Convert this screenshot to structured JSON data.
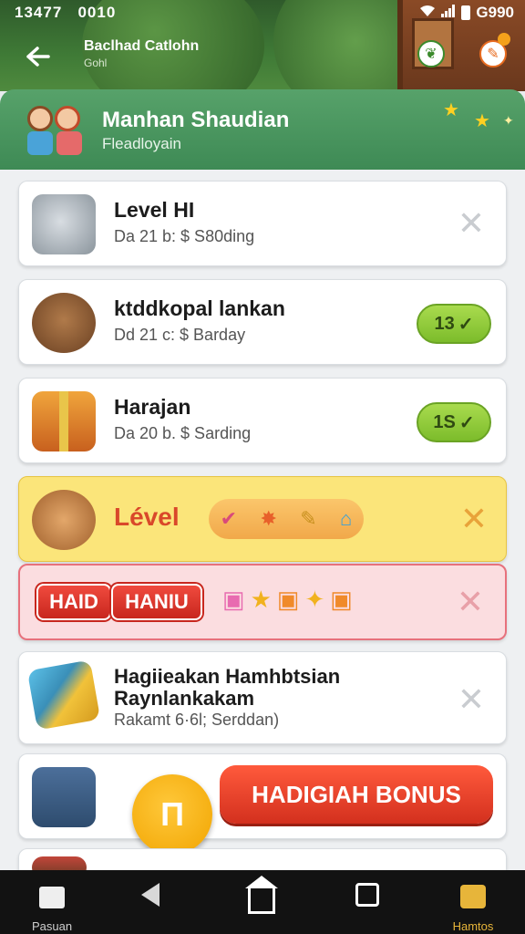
{
  "status": {
    "time": "13477",
    "carrier": "0010",
    "right": "G990"
  },
  "header": {
    "back_icon": "arrow-left-icon",
    "title": "Baclhad Catlohn",
    "subtitle": "Gohl",
    "action1_icon": "leaf-icon",
    "action2_icon": "edit-icon"
  },
  "banner": {
    "title": "Manhan Shaudian",
    "subtitle": "Fleadloyain"
  },
  "cards": [
    {
      "title": "Level HI",
      "subtitle": "Da 21 b: $ S80ding",
      "action": "close"
    },
    {
      "title": "ktddkopal lankan",
      "subtitle": "Dd 21 c: $ Barday",
      "pill": "13"
    },
    {
      "title": "Harajan",
      "subtitle": "Da 20 b. $ Sarding",
      "pill": "1S"
    },
    {
      "title": "Lével"
    },
    {
      "pill1": "HAID",
      "pill2": "HANIU"
    },
    {
      "title_line1": "Hagiieakan Hamhbtsian",
      "title_line2": "Raynlankakam",
      "subtitle": "Rakamt 6·6l; Serddan)"
    },
    {
      "fab": "П",
      "button": "HADIGIAH BONUS"
    }
  ],
  "nav": [
    {
      "label": "Pasuan",
      "icon": "home-icon"
    },
    {
      "label": "",
      "icon": "back-triangle-icon"
    },
    {
      "label": "",
      "icon": "home-outline-icon"
    },
    {
      "label": "",
      "icon": "square-icon"
    },
    {
      "label": "Hamtos",
      "icon": "bag-icon"
    }
  ],
  "colors": {
    "accent_green": "#3e8a55",
    "bonus_red": "#d3301e",
    "fab_yellow": "#f1a400"
  }
}
